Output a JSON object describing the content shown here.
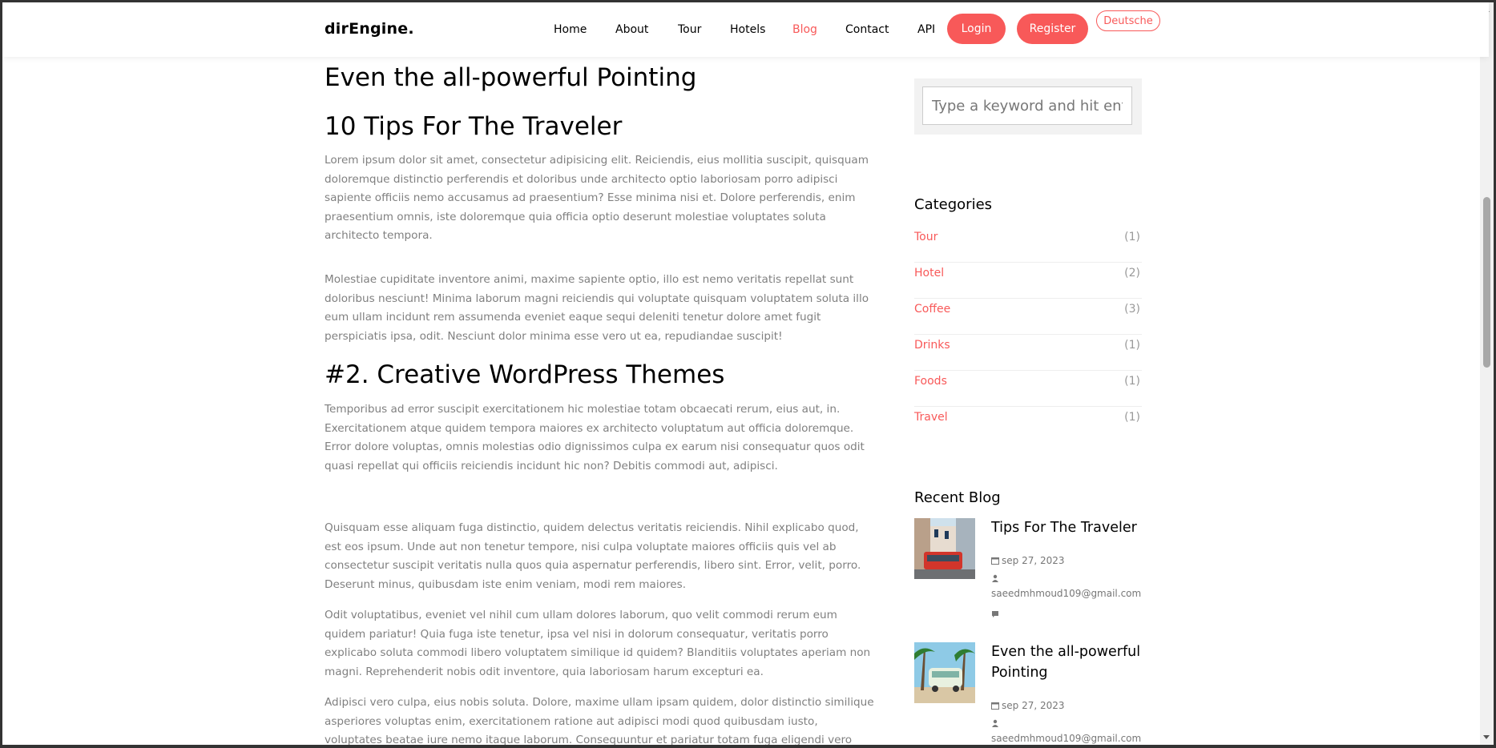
{
  "navbar": {
    "brand": "dirEngine.",
    "items": [
      "Home",
      "About",
      "Tour",
      "Hotels",
      "Blog",
      "Contact",
      "API"
    ],
    "active_item": "Blog",
    "login_label": "Login",
    "register_label": "Register",
    "language_label": "Deutsche"
  },
  "article": {
    "heading_top": "Even the all-powerful Pointing",
    "heading_tips": "10 Tips For The Traveler",
    "para1": "Lorem ipsum dolor sit amet, consectetur adipisicing elit. Reiciendis, eius mollitia suscipit, quisquam doloremque distinctio perferendis et doloribus unde architecto optio laboriosam porro adipisci sapiente officiis nemo accusamus ad praesentium? Esse minima nisi et. Dolore perferendis, enim praesentium omnis, iste doloremque quia officia optio deserunt molestiae voluptates soluta architecto tempora.",
    "para2": "Molestiae cupiditate inventore animi, maxime sapiente optio, illo est nemo veritatis repellat sunt doloribus nesciunt! Minima laborum magni reiciendis qui voluptate quisquam voluptatem soluta illo eum ullam incidunt rem assumenda eveniet eaque sequi deleniti tenetur dolore amet fugit perspiciatis ipsa, odit. Nesciunt dolor minima esse vero ut ea, repudiandae suscipit!",
    "heading_themes": "#2. Creative WordPress Themes",
    "para3": "Temporibus ad error suscipit exercitationem hic molestiae totam obcaecati rerum, eius aut, in. Exercitationem atque quidem tempora maiores ex architecto voluptatum aut officia doloremque. Error dolore voluptas, omnis molestias odio dignissimos culpa ex earum nisi consequatur quos odit quasi repellat qui officiis reiciendis incidunt hic non? Debitis commodi aut, adipisci.",
    "para4": "Quisquam esse aliquam fuga distinctio, quidem delectus veritatis reiciendis. Nihil explicabo quod, est eos ipsum. Unde aut non tenetur tempore, nisi culpa voluptate maiores officiis quis vel ab consectetur suscipit veritatis nulla quos quia aspernatur perferendis, libero sint. Error, velit, porro. Deserunt minus, quibusdam iste enim veniam, modi rem maiores.",
    "para5": "Odit voluptatibus, eveniet vel nihil cum ullam dolores laborum, quo velit commodi rerum eum quidem pariatur! Quia fuga iste tenetur, ipsa vel nisi in dolorum consequatur, veritatis porro explicabo soluta commodi libero voluptatem similique id quidem? Blanditiis voluptates aperiam non magni. Reprehenderit nobis odit inventore, quia laboriosam harum excepturi ea.",
    "para6": "Adipisci vero culpa, eius nobis soluta. Dolore, maxime ullam ipsam quidem, dolor distinctio similique asperiores voluptas enim, exercitationem ratione aut adipisci modi quod quibusdam iusto, voluptates beatae iure nemo itaque laborum. Consequuntur et pariatur totam fuga eligendi vero dolorum"
  },
  "sidebar": {
    "search_placeholder": "Type a keyword and hit enter",
    "categories_title": "Categories",
    "categories": [
      {
        "name": "Tour",
        "count": "(1)"
      },
      {
        "name": "Hotel",
        "count": "(2)"
      },
      {
        "name": "Coffee",
        "count": "(3)"
      },
      {
        "name": "Drinks",
        "count": "(1)"
      },
      {
        "name": "Foods",
        "count": "(1)"
      },
      {
        "name": "Travel",
        "count": "(1)"
      }
    ],
    "recent_title": "Recent Blog",
    "recent": [
      {
        "title": "Tips For The Traveler",
        "date": "sep 27, 2023",
        "author": "saeedmhmoud109@gmail.com"
      },
      {
        "title": "Even the all-powerful Pointing",
        "date": "sep 27, 2023",
        "author": "saeedmhmoud109@gmail.com"
      }
    ]
  },
  "colors": {
    "accent": "#f85959",
    "body_text": "#808080",
    "heading": "#000000"
  }
}
